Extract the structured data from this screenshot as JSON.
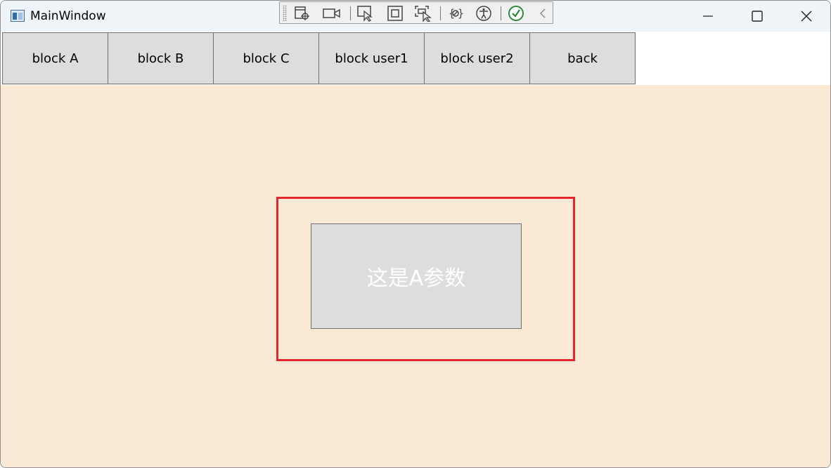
{
  "window": {
    "title": "MainWindow"
  },
  "titlebar_icons": {
    "minimize": "minimize-icon",
    "maximize": "maximize-icon",
    "close": "close-icon"
  },
  "dev_toolbar": {
    "tools": [
      "live-visual-tree-icon",
      "record-icon",
      "select-element-icon",
      "display-layout-adorners-icon",
      "track-focus-icon",
      "binding-failures-icon",
      "accessibility-icon",
      "check-icon",
      "collapse-chevron-icon"
    ]
  },
  "tabs": [
    {
      "label": "block A"
    },
    {
      "label": "block B"
    },
    {
      "label": "block C"
    },
    {
      "label": "block user1"
    },
    {
      "label": "block user2"
    },
    {
      "label": "back"
    }
  ],
  "content": {
    "param_text": "这是A参数"
  },
  "colors": {
    "content_background": "#f9e9d5",
    "highlight_border": "#e3262e",
    "button_background": "#dddddd"
  }
}
